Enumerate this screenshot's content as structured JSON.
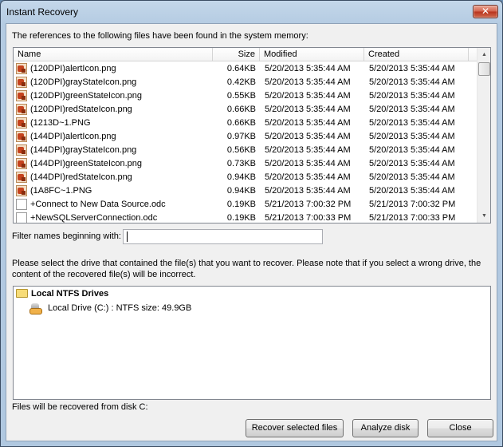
{
  "window": {
    "title": "Instant Recovery",
    "close_glyph": "✕"
  },
  "intro_text": "The references to the following files have been found in the system memory:",
  "file_list": {
    "columns": [
      "Name",
      "Size",
      "Modified",
      "Created"
    ],
    "rows": [
      {
        "name": "(120DPI)alertIcon.png",
        "size": "0.64KB",
        "modified": "5/20/2013 5:35:44 AM",
        "created": "5/20/2013 5:35:44 AM",
        "icon": "image-file-icon"
      },
      {
        "name": "(120DPI)grayStateIcon.png",
        "size": "0.42KB",
        "modified": "5/20/2013 5:35:44 AM",
        "created": "5/20/2013 5:35:44 AM",
        "icon": "image-file-icon"
      },
      {
        "name": "(120DPI)greenStateIcon.png",
        "size": "0.55KB",
        "modified": "5/20/2013 5:35:44 AM",
        "created": "5/20/2013 5:35:44 AM",
        "icon": "image-file-icon"
      },
      {
        "name": "(120DPI)redStateIcon.png",
        "size": "0.66KB",
        "modified": "5/20/2013 5:35:44 AM",
        "created": "5/20/2013 5:35:44 AM",
        "icon": "image-file-icon"
      },
      {
        "name": "(1213D~1.PNG",
        "size": "0.66KB",
        "modified": "5/20/2013 5:35:44 AM",
        "created": "5/20/2013 5:35:44 AM",
        "icon": "image-file-icon"
      },
      {
        "name": "(144DPI)alertIcon.png",
        "size": "0.97KB",
        "modified": "5/20/2013 5:35:44 AM",
        "created": "5/20/2013 5:35:44 AM",
        "icon": "image-file-icon"
      },
      {
        "name": "(144DPI)grayStateIcon.png",
        "size": "0.56KB",
        "modified": "5/20/2013 5:35:44 AM",
        "created": "5/20/2013 5:35:44 AM",
        "icon": "image-file-icon"
      },
      {
        "name": "(144DPI)greenStateIcon.png",
        "size": "0.73KB",
        "modified": "5/20/2013 5:35:44 AM",
        "created": "5/20/2013 5:35:44 AM",
        "icon": "image-file-icon"
      },
      {
        "name": "(144DPI)redStateIcon.png",
        "size": "0.94KB",
        "modified": "5/20/2013 5:35:44 AM",
        "created": "5/20/2013 5:35:44 AM",
        "icon": "image-file-icon"
      },
      {
        "name": "(1A8FC~1.PNG",
        "size": "0.94KB",
        "modified": "5/20/2013 5:35:44 AM",
        "created": "5/20/2013 5:35:44 AM",
        "icon": "image-file-icon"
      },
      {
        "name": "+Connect to New Data Source.odc",
        "size": "0.19KB",
        "modified": "5/21/2013 7:00:32 PM",
        "created": "5/21/2013 7:00:32 PM",
        "icon": "document-file-icon"
      },
      {
        "name": "+NewSQLServerConnection.odc",
        "size": "0.19KB",
        "modified": "5/21/2013 7:00:33 PM",
        "created": "5/21/2013 7:00:33 PM",
        "icon": "document-file-icon"
      }
    ],
    "scroll_up_glyph": "▲",
    "scroll_down_glyph": "▼"
  },
  "filter": {
    "label": "Filter names beginning with:",
    "value": ""
  },
  "drive_prompt": {
    "line1": "Please select the drive that contained the file(s) that you want to recover. Please note that if you select a wrong drive, the",
    "line2": "content of the recovered file(s) will be incorrect."
  },
  "drive_tree": {
    "group_label": "Local NTFS Drives",
    "drives": [
      {
        "label": "Local Drive (C:) : NTFS size: 49.9GB"
      }
    ]
  },
  "status_text": "Files will be recovered from disk C:",
  "buttons": {
    "recover": "Recover selected files",
    "analyze": "Analyze disk",
    "close": "Close"
  }
}
